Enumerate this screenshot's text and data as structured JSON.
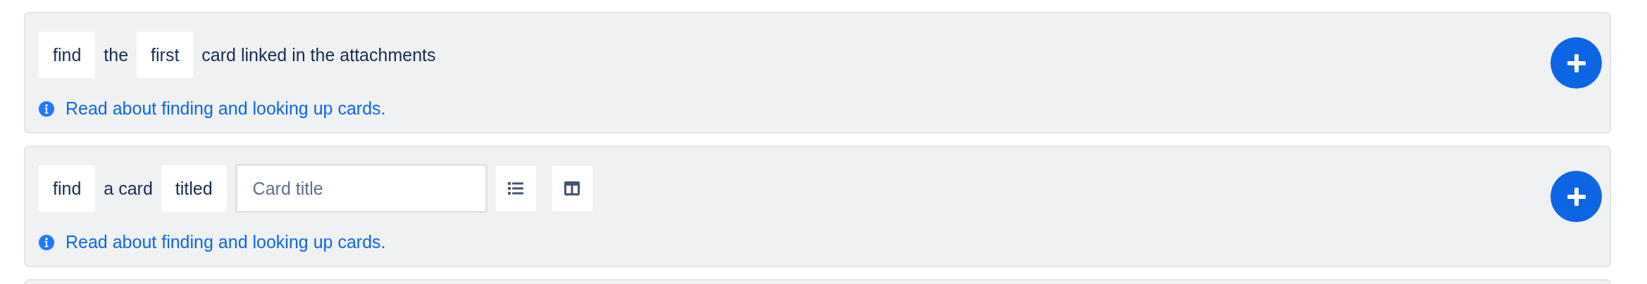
{
  "cards": [
    {
      "parts": [
        {
          "kind": "token",
          "text": "find"
        },
        {
          "kind": "word",
          "text": "the"
        },
        {
          "kind": "token",
          "text": "first"
        },
        {
          "kind": "word",
          "text": "card linked in the attachments"
        }
      ],
      "help_link": "Read about finding and looking up cards."
    },
    {
      "parts": [
        {
          "kind": "token",
          "text": "find"
        },
        {
          "kind": "word",
          "text": "a card"
        },
        {
          "kind": "token",
          "text": "titled"
        },
        {
          "kind": "input",
          "placeholder": "Card title"
        },
        {
          "kind": "list_button"
        },
        {
          "kind": "layout_button"
        }
      ],
      "help_link": "Read about finding and looking up cards."
    }
  ]
}
